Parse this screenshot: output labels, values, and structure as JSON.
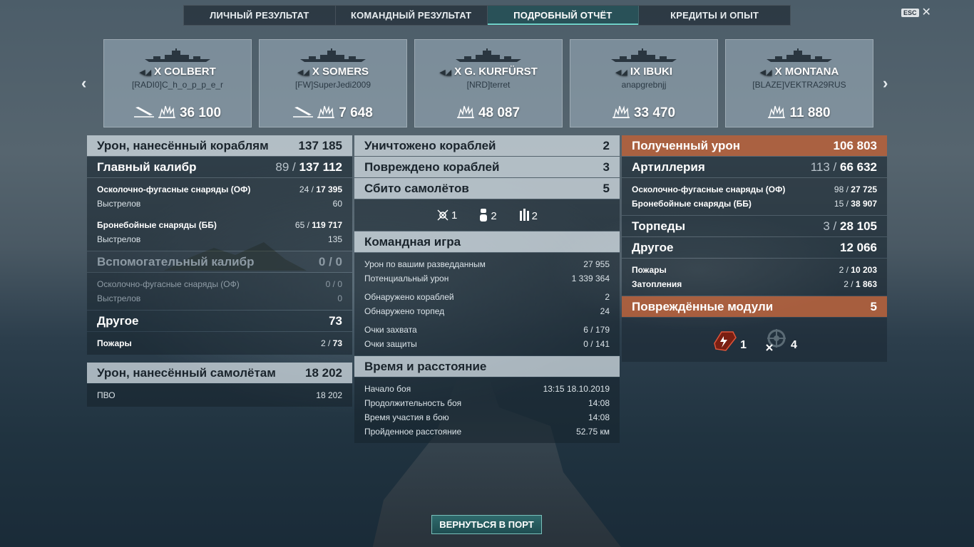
{
  "tabs": [
    "ЛИЧНЫЙ РЕЗУЛЬТАТ",
    "КОМАНДНЫЙ РЕЗУЛЬТАТ",
    "ПОДРОБНЫЙ ОТЧЁТ",
    "КРЕДИТЫ И ОПЫТ"
  ],
  "active_tab": 2,
  "esc_label": "ESC",
  "close_glyph": "✕",
  "cards": [
    {
      "tier": "X",
      "name": "COLBERT",
      "player": "[RADI0]C_h_o_p_p_e_r",
      "damage": "36 100",
      "torpedo": true
    },
    {
      "tier": "X",
      "name": "SOMERS",
      "player": "[FW]SuperJedi2009",
      "damage": "7 648",
      "torpedo": true
    },
    {
      "tier": "X",
      "name": "G. KURFÜRST",
      "player": "[NRD]terret",
      "damage": "48 087",
      "torpedo": false
    },
    {
      "tier": "IX",
      "name": "IBUKI",
      "player": "anapgrebnjj",
      "damage": "33 470",
      "torpedo": false
    },
    {
      "tier": "X",
      "name": "MONTANA",
      "player": "[BLAZE]VEKTRA29RUS",
      "damage": "11 880",
      "torpedo": false
    }
  ],
  "col1": {
    "ship_damage": {
      "label": "Урон, нанесённый кораблям",
      "value": "137 185"
    },
    "main_battery": {
      "label": "Главный калибр",
      "hits": "89",
      "value": "137 112"
    },
    "main_rows": [
      {
        "label": "Осколочно-фугасные снаряды (ОФ)",
        "hits": "24",
        "value": "17 395",
        "bold": true
      },
      {
        "label": "Выстрелов",
        "value": "60",
        "bold": false
      },
      {
        "label": "Бронебойные снаряды (ББ)",
        "hits": "65",
        "value": "119 717",
        "bold": true
      },
      {
        "label": "Выстрелов",
        "value": "135",
        "bold": false
      }
    ],
    "secondary": {
      "label": "Вспомогательный калибр",
      "hits": "0",
      "value": "0"
    },
    "secondary_rows": [
      {
        "label": "Осколочно-фугасные снаряды (ОФ)",
        "hits": "0",
        "value": "0"
      },
      {
        "label": "Выстрелов",
        "value": "0"
      }
    ],
    "other": {
      "label": "Другое",
      "value": "73"
    },
    "other_rows": [
      {
        "label": "Пожары",
        "hits": "2",
        "value": "73"
      }
    ],
    "plane_damage": {
      "label": "Урон, нанесённый самолётам",
      "value": "18 202"
    },
    "plane_rows": [
      {
        "label": "ПВО",
        "value": "18 202"
      }
    ]
  },
  "col2": {
    "destroyed": {
      "label": "Уничтожено кораблей",
      "value": "2"
    },
    "damaged": {
      "label": "Повреждено кораблей",
      "value": "3"
    },
    "planes": {
      "label": "Сбито самолётов",
      "value": "5"
    },
    "plane_icons": [
      {
        "icon": "fighter-icon",
        "count": "1"
      },
      {
        "icon": "bomb-icon",
        "count": "2"
      },
      {
        "icon": "rocket-icon",
        "count": "2"
      }
    ],
    "team": {
      "label": "Командная игра"
    },
    "team_rows1": [
      {
        "label": "Урон по вашим разведданным",
        "value": "27 955"
      },
      {
        "label": "Потенциальный урон",
        "value": "1 339 364"
      }
    ],
    "team_rows2": [
      {
        "label": "Обнаружено кораблей",
        "value": "2"
      },
      {
        "label": "Обнаружено торпед",
        "value": "24"
      }
    ],
    "team_rows3": [
      {
        "label": "Очки захвата",
        "value": "6 / 179"
      },
      {
        "label": "Очки защиты",
        "value": "0 / 141"
      }
    ],
    "time": {
      "label": "Время и расстояние"
    },
    "time_rows": [
      {
        "label": "Начало боя",
        "value": "13:15   18.10.2019"
      },
      {
        "label": "Продолжительность боя",
        "value": "14:08"
      },
      {
        "label": "Время участия в бою",
        "value": "14:08"
      },
      {
        "label": "Пройденное расстояние",
        "value": "52.75 км"
      }
    ]
  },
  "col3": {
    "received": {
      "label": "Полученный урон",
      "value": "106 803"
    },
    "artillery": {
      "label": "Артиллерия",
      "hits": "113",
      "value": "66 632"
    },
    "artillery_rows": [
      {
        "label": "Осколочно-фугасные снаряды (ОФ)",
        "hits": "98",
        "value": "27 725"
      },
      {
        "label": "Бронебойные снаряды (ББ)",
        "hits": "15",
        "value": "38 907"
      }
    ],
    "torpedoes": {
      "label": "Торпеды",
      "hits": "3",
      "value": "28 105"
    },
    "other": {
      "label": "Другое",
      "value": "12 066"
    },
    "other_rows": [
      {
        "label": "Пожары",
        "hits": "2",
        "value": "10 203"
      },
      {
        "label": "Затопления",
        "hits": "2",
        "value": "1 863"
      }
    ],
    "modules": {
      "label": "Повреждённые модули",
      "value": "5"
    },
    "module_icons": [
      {
        "icon": "engine-icon",
        "count": "1"
      },
      {
        "icon": "steering-icon",
        "count": "4"
      }
    ]
  },
  "port_button": "ВЕРНУТЬСЯ В ПОРТ",
  "colors": {
    "accent_orange": "#b4603c",
    "tab_active": "#285a5f",
    "button": "#2f6a6c"
  }
}
